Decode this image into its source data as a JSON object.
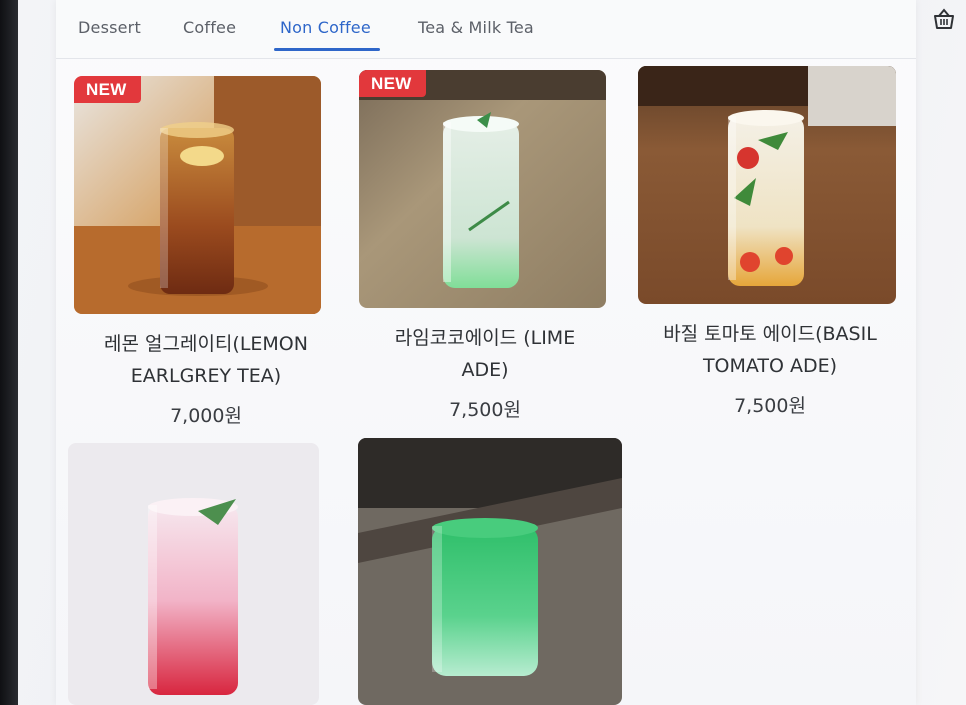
{
  "tabs": [
    {
      "label": "Dessert",
      "active": false
    },
    {
      "label": "Coffee",
      "active": false
    },
    {
      "label": "Non Coffee",
      "active": true
    },
    {
      "label": "Tea & Milk Tea",
      "active": false
    }
  ],
  "cart": {
    "icon": "basket-icon"
  },
  "products": [
    {
      "name_line1": "레몬 얼그레이티(LEMON",
      "name_line2": "EARLGREY TEA)",
      "price": "7,000원",
      "badge": "NEW"
    },
    {
      "name_line1": "라임코코에이드 (LIME",
      "name_line2": "ADE)",
      "price": "7,500원",
      "badge": "NEW"
    },
    {
      "name_line1": "바질 토마토 에이드(BASIL",
      "name_line2": "TOMATO ADE)",
      "price": "7,500원",
      "badge": ""
    },
    {
      "name_line1": "",
      "name_line2": "",
      "price": "",
      "badge": ""
    },
    {
      "name_line1": "",
      "name_line2": "",
      "price": "",
      "badge": ""
    }
  ],
  "colors": {
    "accent": "#2e66c9",
    "badge": "#e2383c"
  }
}
